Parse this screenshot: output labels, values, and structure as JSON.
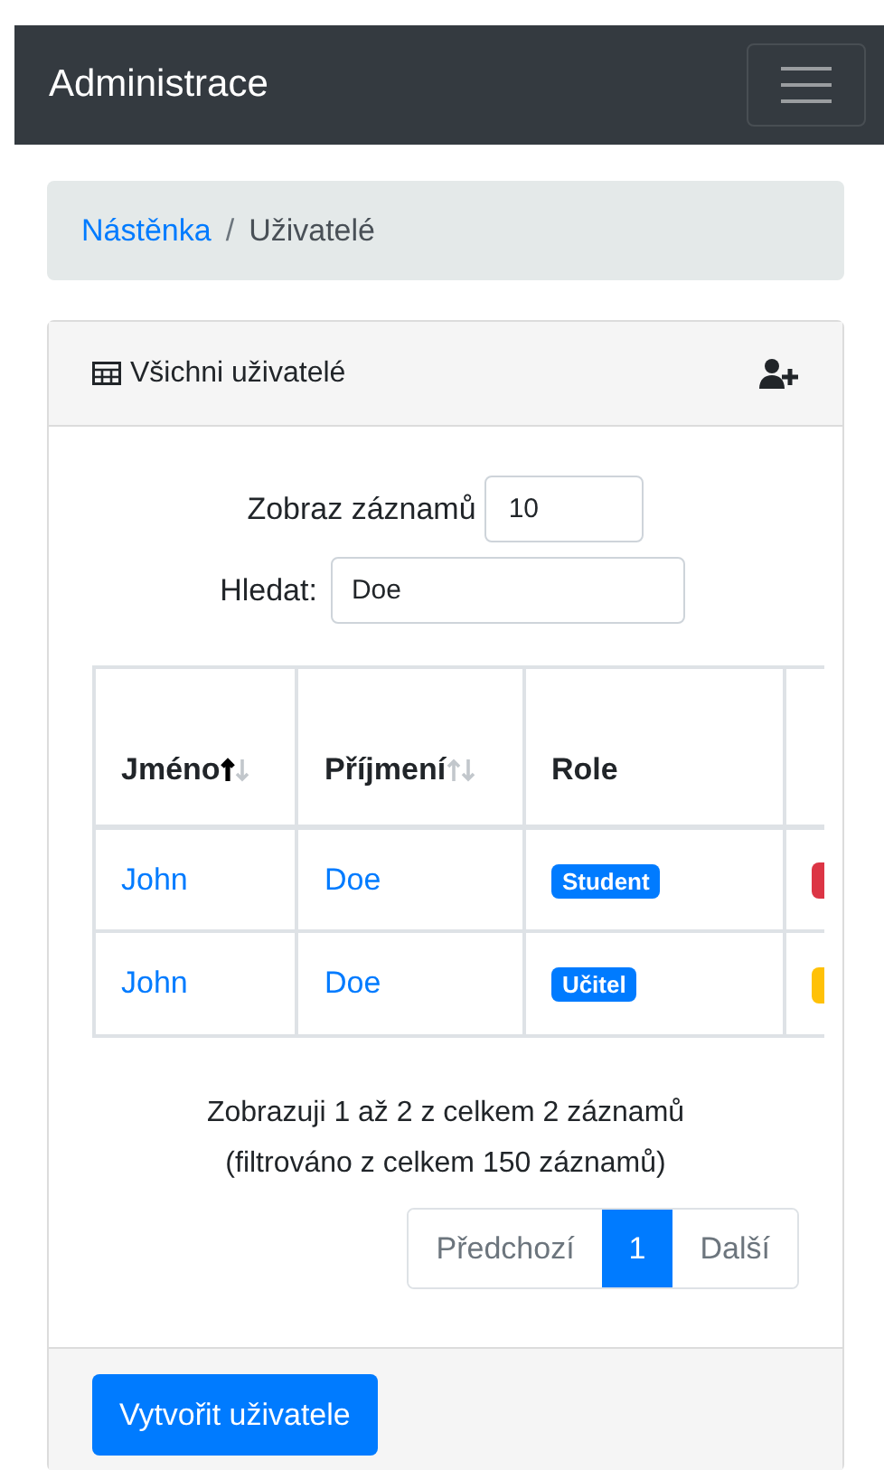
{
  "navbar": {
    "brand": "Administrace"
  },
  "breadcrumb": [
    {
      "label": "Nástěnka",
      "link": true
    },
    {
      "label": "Uživatelé",
      "link": false
    }
  ],
  "breadcrumb_separator": "/",
  "card": {
    "title": "Všichni uživatelé"
  },
  "length": {
    "label": "Zobraz záznamů",
    "value": "10"
  },
  "search": {
    "label": "Hledat:",
    "value": "Doe"
  },
  "table": {
    "columns": [
      {
        "label": "Jméno",
        "sortable": true,
        "sorted": true
      },
      {
        "label": "Příjmení",
        "sortable": true,
        "sorted": false
      },
      {
        "label": "Role",
        "sortable": false
      }
    ],
    "rows": [
      {
        "first": "John",
        "last": "Doe",
        "role": "Student",
        "column_4": {
          "color": "#dc3545"
        }
      },
      {
        "first": "John",
        "last": "Doe",
        "role": "Učitel",
        "column_4": {
          "color": "#ffc107"
        }
      }
    ]
  },
  "info": [
    "Zobrazuji 1 až 2 z celkem 2 záznamů",
    "(filtrováno z celkem 150 záznamů)"
  ],
  "pagination": [
    {
      "label": "Předchozí",
      "selected": false
    },
    {
      "label": "1",
      "selected": true
    },
    {
      "label": "Další",
      "selected": false
    }
  ],
  "create_button": "Vytvořit uživatele"
}
